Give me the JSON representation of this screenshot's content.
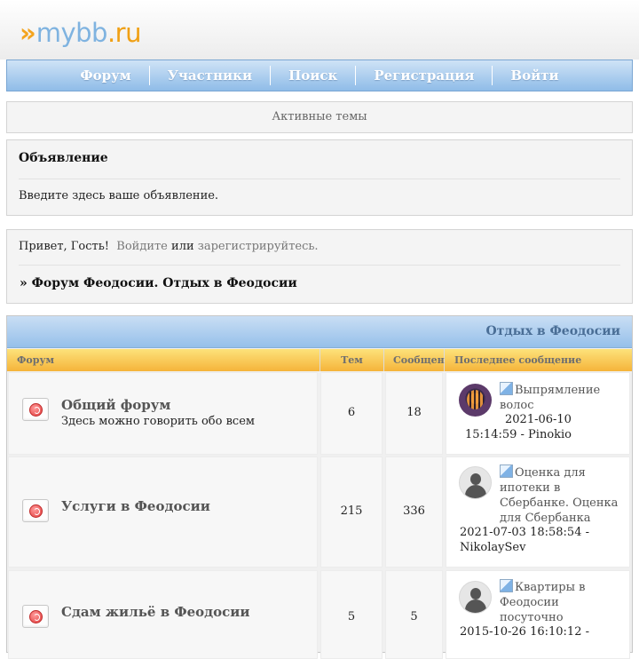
{
  "logo": {
    "arrows": "»",
    "name": "mybb",
    "tld": ".ru"
  },
  "nav": [
    "Форум",
    "Участники",
    "Поиск",
    "Регистрация",
    "Войти"
  ],
  "active_topics": "Активные темы",
  "announcement": {
    "title": "Объявление",
    "body": "Введите здесь ваше объявление."
  },
  "welcome": {
    "greeting": "Привет, Гость!",
    "login": "Войдите",
    "or": "или",
    "register": "зарегистрируйтесь."
  },
  "breadcrumb": "» Форум Феодосии. Отдых в Феодосии",
  "category": {
    "title": "Отдых в Феодосии",
    "columns": {
      "forum": "Форум",
      "topics": "Тем",
      "posts": "Сообщений",
      "last": "Последнее сообщение"
    },
    "forums": [
      {
        "name": "Общий форум",
        "description": "Здесь можно говорить обо всем",
        "topics": "6",
        "posts": "18",
        "avatar": "tiger-avatar",
        "last_topic": "Выпрямление волос",
        "last_date": "2021-06-10",
        "last_time_user": "15:14:59 - Pinokio"
      },
      {
        "name": "Услуги в Феодосии",
        "description": "",
        "topics": "215",
        "posts": "336",
        "avatar": "default-avatar",
        "last_topic": "Оценка для ипотеки в Сбербанке. Оценка для Сбербанка",
        "last_date": "2021-07-03 18:58:54 -",
        "last_time_user": "NikolaySev"
      },
      {
        "name": "Сдам жильё в Феодосии",
        "description": "",
        "topics": "5",
        "posts": "5",
        "avatar": "default-avatar",
        "last_topic": "Квартиры в Феодосии посуточно",
        "last_date": "2015-10-26 16:10:12 -",
        "last_time_user": ""
      }
    ]
  }
}
